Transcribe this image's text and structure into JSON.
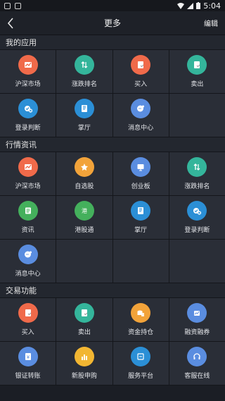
{
  "status": {
    "time": "5:04"
  },
  "nav": {
    "title": "更多",
    "edit": "编辑"
  },
  "sections": [
    {
      "title": "我的应用",
      "items": [
        {
          "label": "沪深市场",
          "icon": "chart-trend-icon",
          "color": "#f06a4a",
          "glyph": "chart"
        },
        {
          "label": "涨跌排名",
          "icon": "sort-arrows-icon",
          "color": "#34b59b",
          "glyph": "updown"
        },
        {
          "label": "买入",
          "icon": "buy-icon",
          "color": "#f06a4a",
          "glyph": "doc"
        },
        {
          "label": "卖出",
          "icon": "sell-icon",
          "color": "#34b59b",
          "glyph": "doc"
        },
        {
          "label": "登录判断",
          "icon": "login-check-icon",
          "color": "#2b8fd6",
          "glyph": "check"
        },
        {
          "label": "掌厅",
          "icon": "hall-icon",
          "color": "#2b8fd6",
          "glyph": "book"
        },
        {
          "label": "消息中心",
          "icon": "message-icon",
          "color": "#5a8de0",
          "glyph": "msg"
        }
      ]
    },
    {
      "title": "行情资讯",
      "items": [
        {
          "label": "沪深市场",
          "icon": "chart-trend-icon",
          "color": "#f06a4a",
          "glyph": "chart"
        },
        {
          "label": "自选股",
          "icon": "star-icon",
          "color": "#f2a33a",
          "glyph": "star"
        },
        {
          "label": "创业板",
          "icon": "board-icon",
          "color": "#5a8de0",
          "glyph": "board"
        },
        {
          "label": "涨跌排名",
          "icon": "sort-arrows-icon",
          "color": "#34b59b",
          "glyph": "updown"
        },
        {
          "label": "资讯",
          "icon": "news-icon",
          "color": "#44b05c",
          "glyph": "news"
        },
        {
          "label": "港股通",
          "icon": "hk-connect-icon",
          "color": "#44b05c",
          "glyph": "hk"
        },
        {
          "label": "掌厅",
          "icon": "hall-icon",
          "color": "#2b8fd6",
          "glyph": "book"
        },
        {
          "label": "登录判断",
          "icon": "login-check-icon",
          "color": "#2b8fd6",
          "glyph": "check"
        },
        {
          "label": "消息中心",
          "icon": "message-icon",
          "color": "#5a8de0",
          "glyph": "msg"
        }
      ]
    },
    {
      "title": "交易功能",
      "items": [
        {
          "label": "买入",
          "icon": "buy-icon",
          "color": "#f06a4a",
          "glyph": "doc"
        },
        {
          "label": "卖出",
          "icon": "sell-icon",
          "color": "#34b59b",
          "glyph": "doc"
        },
        {
          "label": "资金持仓",
          "icon": "coins-icon",
          "color": "#f2a33a",
          "glyph": "coins"
        },
        {
          "label": "融资融券",
          "icon": "margin-icon",
          "color": "#5a8de0",
          "glyph": "margin"
        },
        {
          "label": "银证转账",
          "icon": "bank-transfer-icon",
          "color": "#5a8de0",
          "glyph": "yen"
        },
        {
          "label": "新股申购",
          "icon": "ipo-icon",
          "color": "#f2b632",
          "glyph": "bars"
        },
        {
          "label": "服务平台",
          "icon": "service-icon",
          "color": "#2b8fd6",
          "glyph": "scan"
        },
        {
          "label": "客服在线",
          "icon": "headset-icon",
          "color": "#5a8de0",
          "glyph": "headset"
        }
      ]
    }
  ]
}
